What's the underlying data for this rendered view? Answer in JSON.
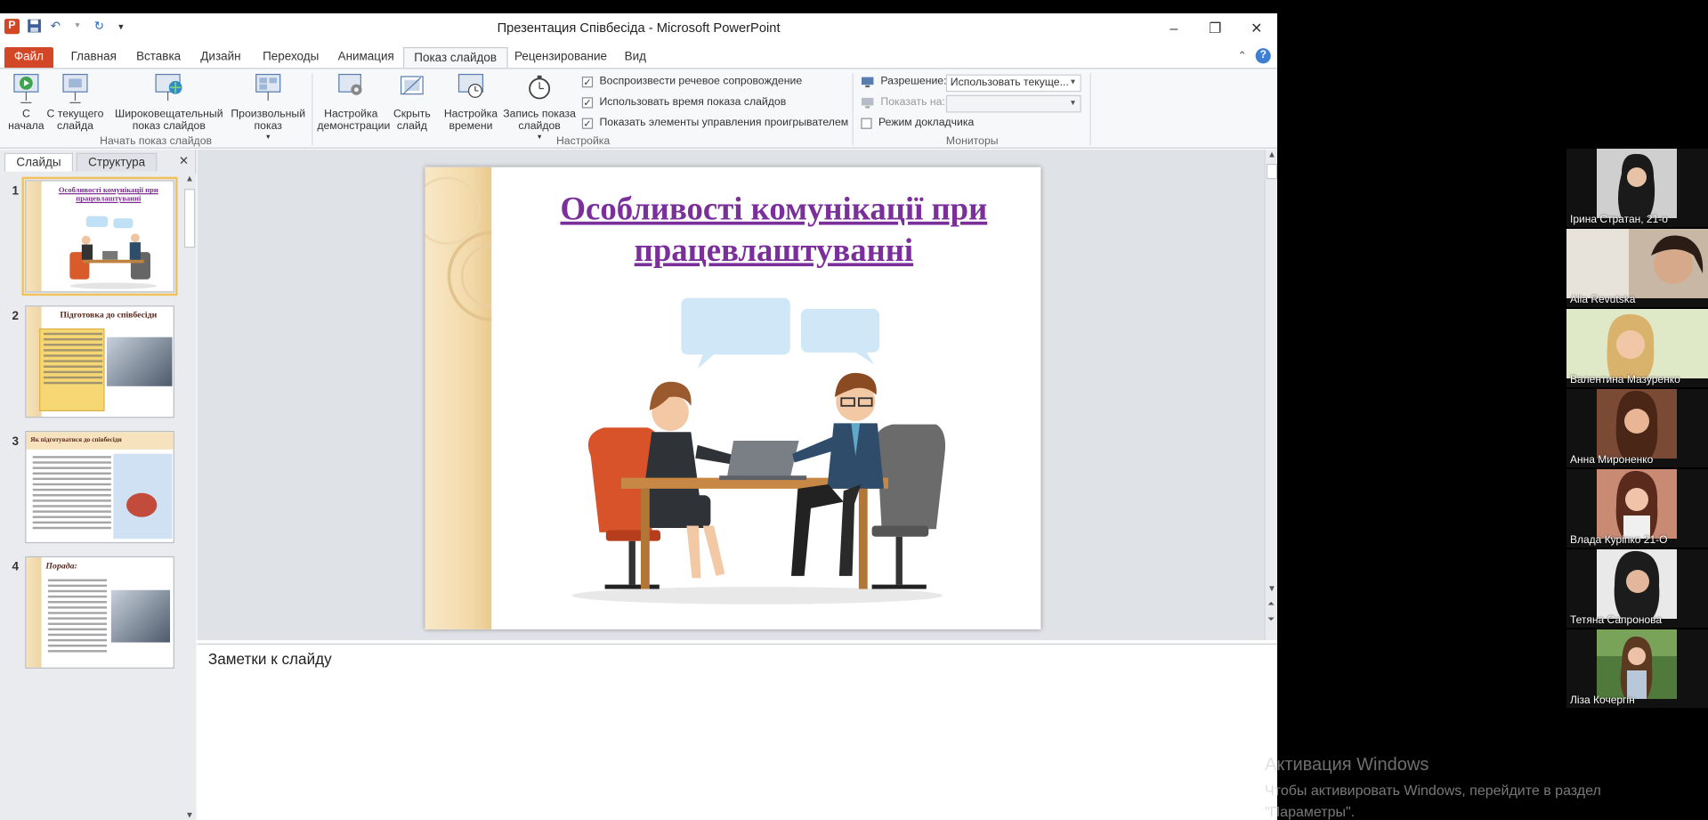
{
  "window": {
    "title": "Презентация Співбесіда  -  Microsoft PowerPoint",
    "minimize": "–",
    "restore": "❐",
    "close": "✕"
  },
  "tabs": {
    "file": "Файл",
    "items": [
      "Главная",
      "Вставка",
      "Дизайн",
      "Переходы",
      "Анимация",
      "Показ слайдов",
      "Рецензирование",
      "Вид"
    ],
    "active": "Показ слайдов"
  },
  "ribbon": {
    "from_beginning": "С начала",
    "from_current": "С текущего слайда",
    "broadcast": "Широковещательный показ слайдов",
    "custom_show": "Произвольный показ",
    "group_start": "Начать показ слайдов",
    "setup_show": "Настройка демонстрации",
    "hide_slide": "Скрыть слайд",
    "rehearse": "Настройка времени",
    "record": "Запись показа слайдов",
    "chk_narration": "Воспроизвести речевое сопровождение",
    "chk_timings": "Использовать время показа слайдов",
    "chk_media": "Показать элементы управления проигрывателем",
    "group_setup": "Настройка",
    "resolution_label": "Разрешение:",
    "resolution_value": "Использовать текуще...",
    "show_on_label": "Показать на:",
    "presenter_view": "Режим докладчика",
    "group_monitors": "Мониторы"
  },
  "panel": {
    "tab_slides": "Слайды",
    "tab_outline": "Структура",
    "close": "✕"
  },
  "thumbnails": [
    {
      "num": "1",
      "title": "Особливості комунікації при працевлаштуванні"
    },
    {
      "num": "2",
      "title": "Підготовка до співбесіди"
    },
    {
      "num": "3",
      "title": "Як підготуватися до співбесіди"
    },
    {
      "num": "4",
      "title": "Порада:"
    }
  ],
  "slide": {
    "title": "Особливості комунікації при працевлаштуванні"
  },
  "notes": {
    "placeholder": "Заметки к слайду"
  },
  "participants": [
    {
      "name": "Ірина Стратан, 21-о"
    },
    {
      "name": "Alla Revutska"
    },
    {
      "name": "Валентина Мазуренко"
    },
    {
      "name": "Анна Мироненко"
    },
    {
      "name": "Влада Курiпко 21-О"
    },
    {
      "name": "Тетяна Сапронова"
    },
    {
      "name": "Ліза Кочергін"
    }
  ],
  "watermark": {
    "line1": "Активация Windows",
    "line2": "Чтобы активировать Windows, перейдите в раздел",
    "line3": "\"Параметры\"."
  },
  "colors": {
    "file_tab": "#d24726",
    "slide_title": "#7b2f9a"
  }
}
